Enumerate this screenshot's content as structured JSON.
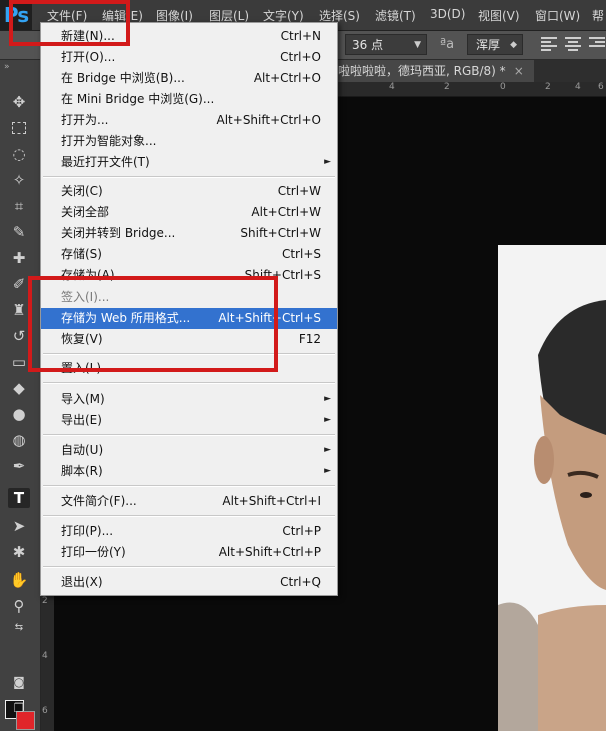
{
  "app": {
    "logo": "Ps"
  },
  "menubar": {
    "items": [
      "文件(F)",
      "编辑(E)",
      "图像(I)",
      "图层(L)",
      "文字(Y)",
      "选择(S)",
      "滤镜(T)",
      "3D(D)",
      "视图(V)",
      "窗口(W)",
      "帮"
    ]
  },
  "options": {
    "font_size": "36 点",
    "aa_symbol": "ªa",
    "aa_mode": "浑厚"
  },
  "document_tab": {
    "title": "啦啦啦啦，德玛西亚, RGB/8) *",
    "close": "×"
  },
  "rulers": {
    "top_labels": [
      "4",
      "2",
      "0",
      "2",
      "4",
      "6"
    ],
    "left_labels": [
      "2",
      "4",
      "6"
    ]
  },
  "toolbar": {
    "collapse": "»",
    "type_tool": "T"
  },
  "file_menu": {
    "items": [
      {
        "label": "新建(N)...",
        "shortcut": "Ctrl+N",
        "state": "normal"
      },
      {
        "label": "打开(O)...",
        "shortcut": "Ctrl+O",
        "state": "normal"
      },
      {
        "label": "在 Bridge 中浏览(B)...",
        "shortcut": "Alt+Ctrl+O",
        "state": "normal"
      },
      {
        "label": "在 Mini Bridge 中浏览(G)...",
        "shortcut": "",
        "state": "normal"
      },
      {
        "label": "打开为...",
        "shortcut": "Alt+Shift+Ctrl+O",
        "state": "normal"
      },
      {
        "label": "打开为智能对象...",
        "shortcut": "",
        "state": "normal"
      },
      {
        "label": "最近打开文件(T)",
        "shortcut": "",
        "state": "submenu"
      },
      {
        "label": "关闭(C)",
        "shortcut": "Ctrl+W",
        "state": "normal"
      },
      {
        "label": "关闭全部",
        "shortcut": "Alt+Ctrl+W",
        "state": "normal"
      },
      {
        "label": "关闭并转到 Bridge...",
        "shortcut": "Shift+Ctrl+W",
        "state": "normal"
      },
      {
        "label": "存储(S)",
        "shortcut": "Ctrl+S",
        "state": "normal"
      },
      {
        "label": "存储为(A)...",
        "shortcut": "Shift+Ctrl+S",
        "state": "normal"
      },
      {
        "label": "签入(I)...",
        "shortcut": "",
        "state": "disabled"
      },
      {
        "label": "存储为 Web 所用格式...",
        "shortcut": "Alt+Shift+Ctrl+S",
        "state": "highlighted"
      },
      {
        "label": "恢复(V)",
        "shortcut": "F12",
        "state": "normal"
      },
      {
        "label": "置入(L)...",
        "shortcut": "",
        "state": "normal"
      },
      {
        "label": "导入(M)",
        "shortcut": "",
        "state": "submenu"
      },
      {
        "label": "导出(E)",
        "shortcut": "",
        "state": "submenu"
      },
      {
        "label": "自动(U)",
        "shortcut": "",
        "state": "submenu"
      },
      {
        "label": "脚本(R)",
        "shortcut": "",
        "state": "submenu"
      },
      {
        "label": "文件简介(F)...",
        "shortcut": "Alt+Shift+Ctrl+I",
        "state": "normal"
      },
      {
        "label": "打印(P)...",
        "shortcut": "Ctrl+P",
        "state": "normal"
      },
      {
        "label": "打印一份(Y)",
        "shortcut": "Alt+Shift+Ctrl+P",
        "state": "normal"
      },
      {
        "label": "退出(X)",
        "shortcut": "Ctrl+Q",
        "state": "normal"
      }
    ],
    "submenu_arrow": "►"
  },
  "colors": {
    "highlight": "#3372cf",
    "annotation_red": "#d21a1a",
    "background_swatch": "#e0252a",
    "foreground_swatch": "#111111"
  }
}
